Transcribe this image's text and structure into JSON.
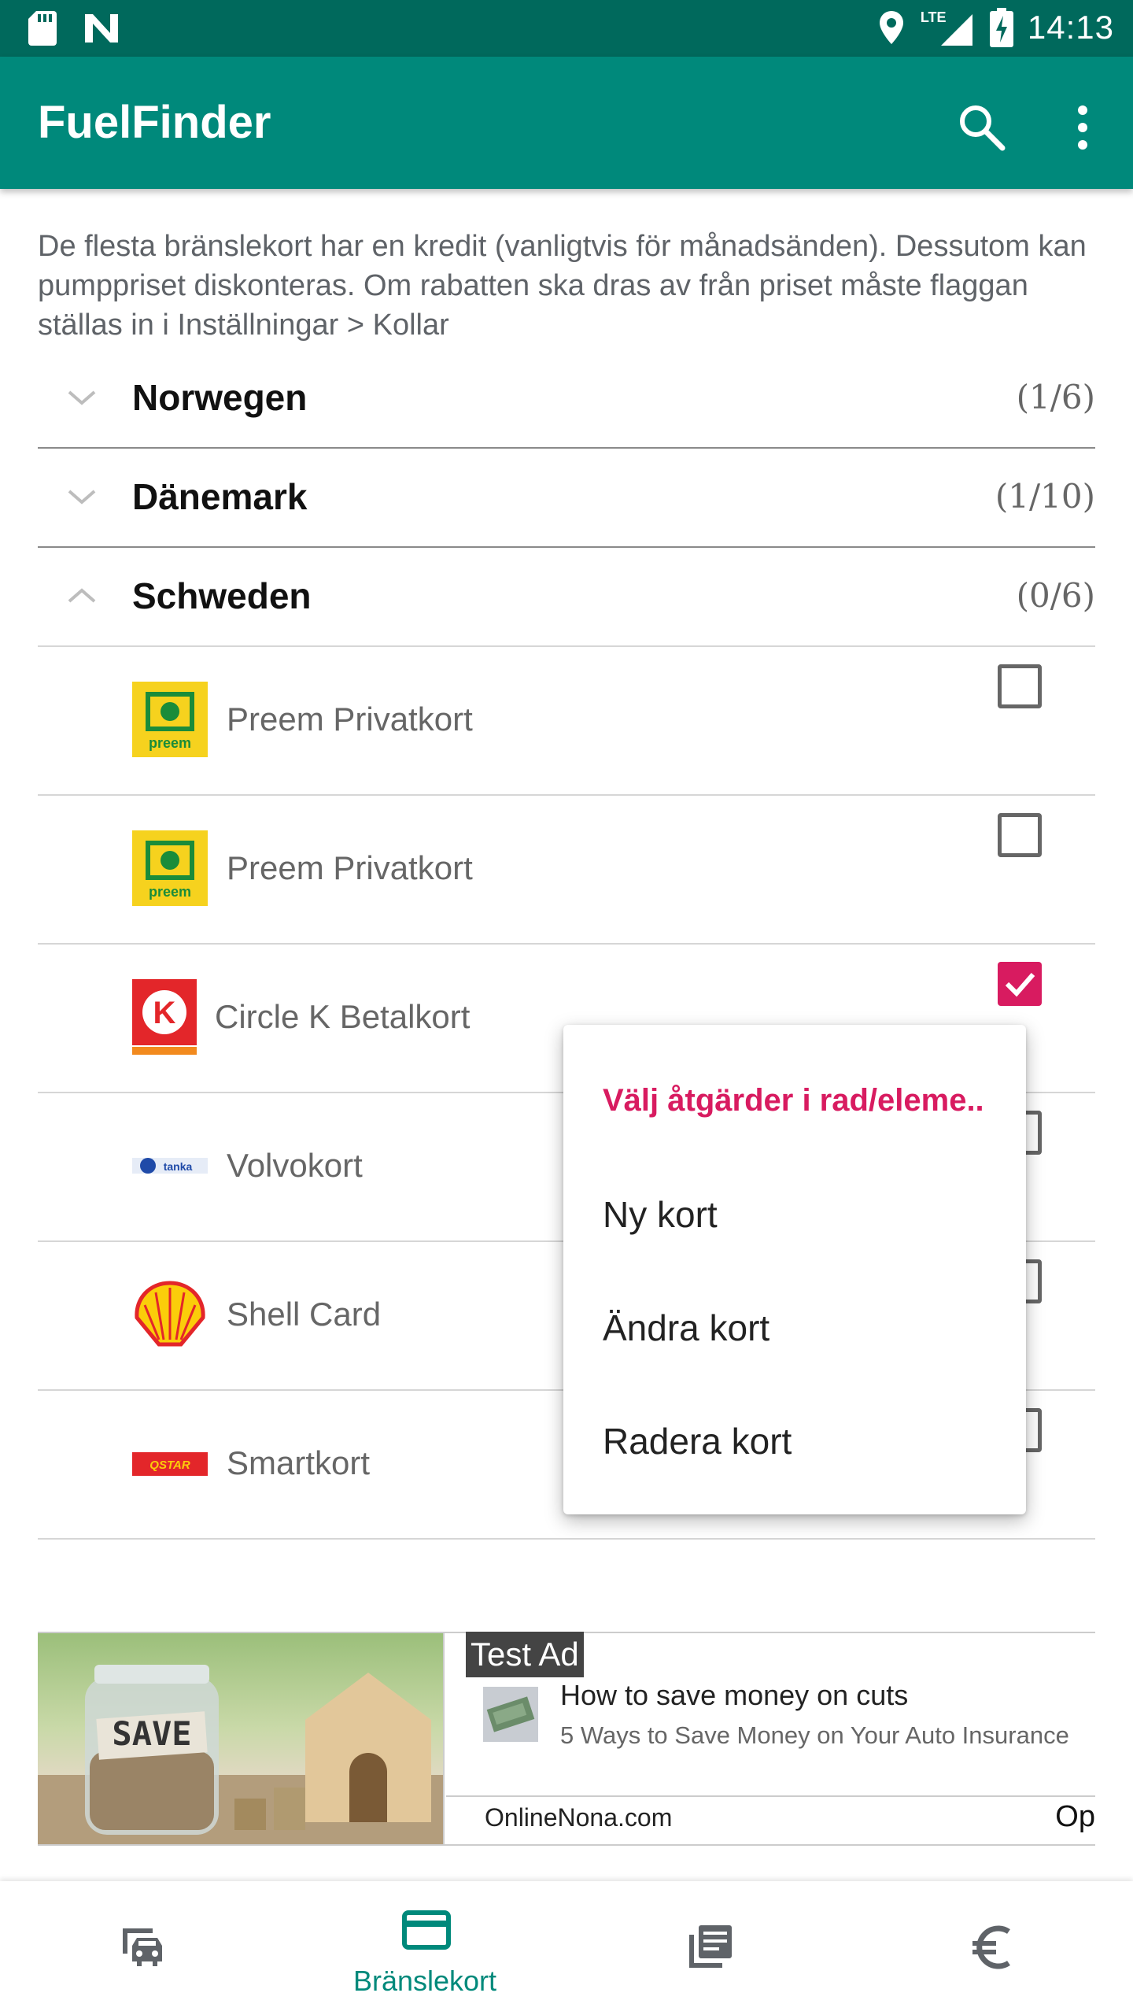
{
  "status_bar": {
    "time": "14:13",
    "network": "LTE",
    "icons": [
      "sd-card-icon",
      "n-logo-icon",
      "location-icon",
      "signal-icon",
      "battery-charging-icon"
    ]
  },
  "app_bar": {
    "title": "FuelFinder",
    "search_icon": "search-icon",
    "more_icon": "more-vert-icon"
  },
  "intro_text": "De flesta bränslekort har en kredit (vanligtvis för månadsänden). Dessutom kan pumppriset diskonteras. Om rabatten ska dras av från priset måste flaggan ställas in i Inställningar > Kollar",
  "groups": [
    {
      "name": "Norwegen",
      "count": "(1/6)",
      "expanded": false
    },
    {
      "name": "Dänemark",
      "count": "(1/10)",
      "expanded": false
    },
    {
      "name": "Schweden",
      "count": "(0/6)",
      "expanded": true
    }
  ],
  "cards": [
    {
      "name": "Preem Privatkort",
      "logo": "preem-logo",
      "logo_text": "preem",
      "checked": false
    },
    {
      "name": "Preem Privatkort",
      "logo": "preem-logo",
      "logo_text": "preem",
      "checked": false
    },
    {
      "name": "Circle K Betalkort",
      "logo": "circle-k-logo",
      "logo_text": "K",
      "checked": true
    },
    {
      "name": "Volvokort",
      "logo": "tanka-logo",
      "logo_text": "tanka",
      "checked": false
    },
    {
      "name": "Shell Card",
      "logo": "shell-logo",
      "logo_text": "",
      "checked": false
    },
    {
      "name": "Smartkort",
      "logo": "qstar-logo",
      "logo_text": "QSTAR",
      "checked": false
    }
  ],
  "popup_menu": {
    "title": "Välj åtgärder i rad/eleme..",
    "items": [
      "Ny kort",
      "Ändra kort",
      "Radera kort"
    ]
  },
  "ad": {
    "tag": "Test Ad",
    "image_text": "SAVE",
    "headline": "How to save money on cuts",
    "subline": "5 Ways to Save Money on Your Auto Insurance",
    "domain": "OnlineNona.com",
    "open_label": "Op"
  },
  "bottom_nav": {
    "items": [
      {
        "icon": "car-connected-icon",
        "label": ""
      },
      {
        "icon": "credit-card-icon",
        "label": "Bränslekort",
        "active": true
      },
      {
        "icon": "library-books-icon",
        "label": ""
      },
      {
        "icon": "euro-icon",
        "label": ""
      }
    ]
  },
  "colors": {
    "status_bar": "#00695c",
    "app_bar": "#00897b",
    "accent": "#d81b60",
    "nav_active": "#00897b"
  }
}
